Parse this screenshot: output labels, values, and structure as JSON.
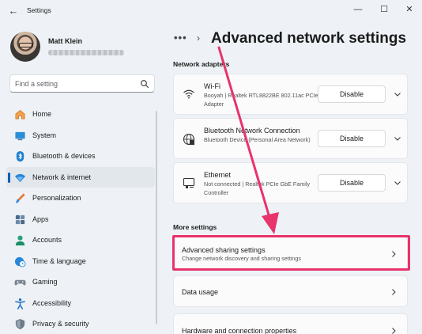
{
  "window": {
    "title": "Settings",
    "controls": [
      "minimize",
      "maximize",
      "close"
    ]
  },
  "user": {
    "name": "Matt Klein"
  },
  "search": {
    "placeholder": "Find a setting"
  },
  "sidebar": {
    "items": [
      {
        "label": "Home",
        "icon": "home-icon",
        "active": false
      },
      {
        "label": "System",
        "icon": "system-icon",
        "active": false
      },
      {
        "label": "Bluetooth & devices",
        "icon": "bluetooth-icon",
        "active": false
      },
      {
        "label": "Network & internet",
        "icon": "network-icon",
        "active": true
      },
      {
        "label": "Personalization",
        "icon": "brush-icon",
        "active": false
      },
      {
        "label": "Apps",
        "icon": "apps-icon",
        "active": false
      },
      {
        "label": "Accounts",
        "icon": "accounts-icon",
        "active": false
      },
      {
        "label": "Time & language",
        "icon": "globe-clock-icon",
        "active": false
      },
      {
        "label": "Gaming",
        "icon": "gamepad-icon",
        "active": false
      },
      {
        "label": "Accessibility",
        "icon": "accessibility-icon",
        "active": false
      },
      {
        "label": "Privacy & security",
        "icon": "shield-icon",
        "active": false
      }
    ]
  },
  "breadcrumb": {
    "dots": "•••",
    "separator": "›",
    "title": "Advanced network settings"
  },
  "network_adapters": {
    "heading": "Network adapters",
    "adapters": [
      {
        "name": "Wi-Fi",
        "detail": "Booyah | Realtek RTL8822BE 802.11ac PCIe Adapter",
        "button": "Disable",
        "icon": "wifi-icon"
      },
      {
        "name": "Bluetooth Network Connection",
        "detail": "Bluetooth Device (Personal Area Network)",
        "button": "Disable",
        "icon": "globe-network-icon"
      },
      {
        "name": "Ethernet",
        "detail": "Not connected | Realtek PCIe GbE Family Controller",
        "button": "Disable",
        "icon": "ethernet-icon"
      }
    ]
  },
  "more_settings": {
    "heading": "More settings",
    "items": [
      {
        "title": "Advanced sharing settings",
        "subtitle": "Change network discovery and sharing settings",
        "highlighted": true
      },
      {
        "title": "Data usage",
        "subtitle": ""
      },
      {
        "title": "Hardware and connection properties",
        "subtitle": ""
      }
    ]
  },
  "colors": {
    "accent": "#005fb8",
    "highlight_annotation": "#e8336b",
    "background": "#eef2f6",
    "card": "#fbfbfc"
  }
}
